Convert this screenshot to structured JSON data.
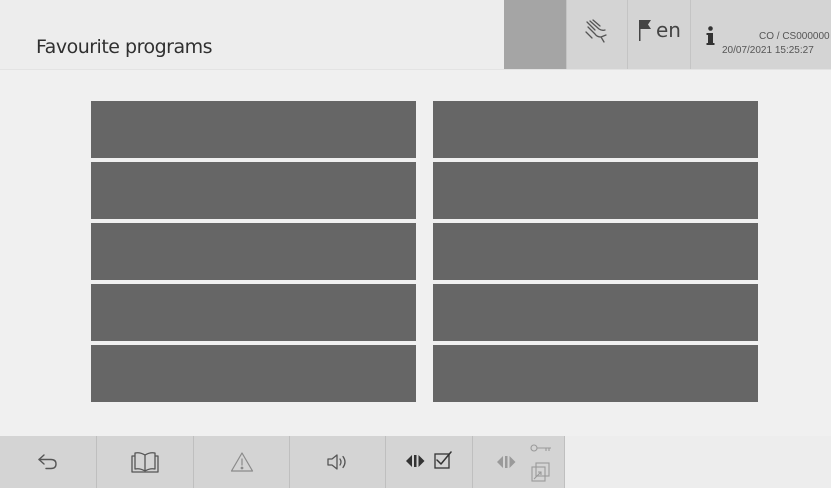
{
  "header": {
    "title": "Favourite programs",
    "language": "en",
    "user_line1": "CO / CS000000",
    "user_line2": "20/07/2021 15:25:27",
    "icons": [
      "hand-touch-icon",
      "flag-icon",
      "info-icon"
    ]
  },
  "favourites": {
    "left_column": [
      "",
      "",
      "",
      "",
      ""
    ],
    "right_column": [
      "",
      "",
      "",
      "",
      ""
    ]
  },
  "footer": {
    "buttons": [
      "back-icon",
      "book-icon",
      "warning-icon",
      "speaker-icon",
      "door-check-icon",
      "door-key-icon"
    ]
  },
  "colors": {
    "background": "#f0f0f0",
    "tile": "#666666",
    "status_bar": "#d4d4d4",
    "status_blank": "#a5a5a5"
  }
}
